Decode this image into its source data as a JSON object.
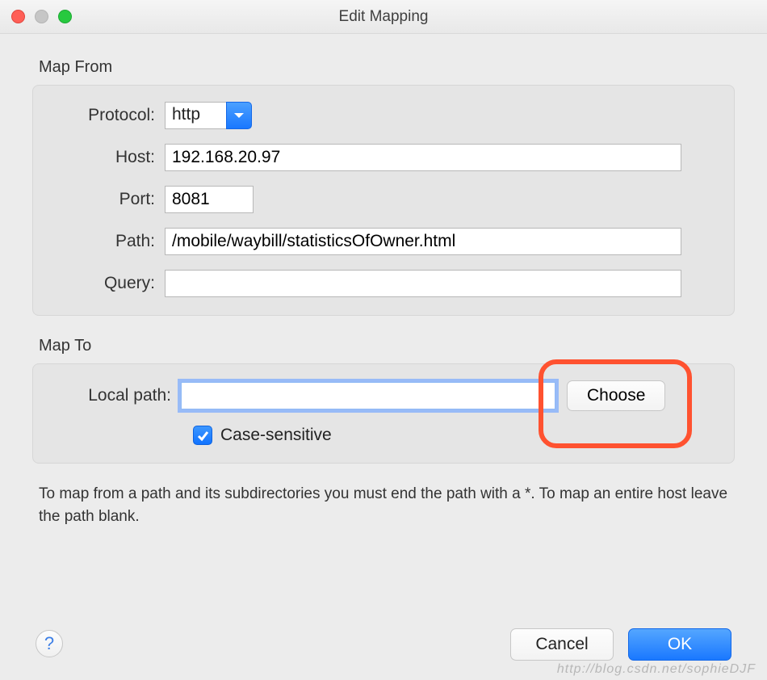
{
  "window": {
    "title": "Edit Mapping"
  },
  "map_from": {
    "section_label": "Map From",
    "protocol_label": "Protocol:",
    "protocol_value": "http",
    "host_label": "Host:",
    "host_value": "192.168.20.97",
    "port_label": "Port:",
    "port_value": "8081",
    "path_label": "Path:",
    "path_value": "/mobile/waybill/statisticsOfOwner.html",
    "query_label": "Query:",
    "query_value": ""
  },
  "map_to": {
    "section_label": "Map To",
    "local_path_label": "Local path:",
    "local_path_value": "",
    "choose_label": "Choose",
    "case_sensitive_label": "Case-sensitive",
    "case_sensitive_checked": true
  },
  "hint": "To map from a path and its subdirectories you must end the path with a *. To map an entire host leave the path blank.",
  "buttons": {
    "help": "?",
    "cancel": "Cancel",
    "ok": "OK"
  },
  "watermark": "http://blog.csdn.net/sophieDJF",
  "colors": {
    "accent_blue": "#1a78ff",
    "highlight_red": "#ff5230"
  }
}
